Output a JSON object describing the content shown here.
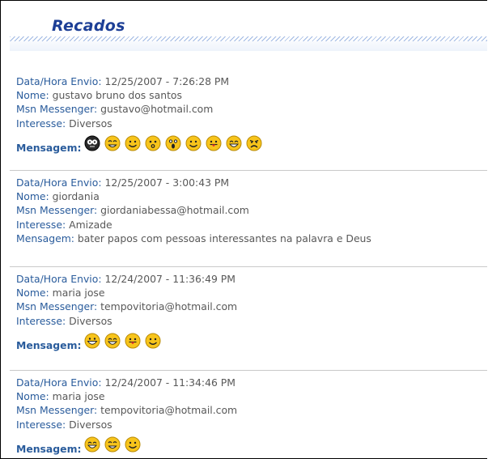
{
  "header": {
    "title": "Recados"
  },
  "posts": [
    {
      "date_label": "Data/Hora Envio:",
      "date": "12/25/2007 - 7:26:28 PM",
      "name_label": "Nome:",
      "name": "gustavo bruno dos santos",
      "msn_label": "Msn Messenger:",
      "msn": "gustavo@hotmail.com",
      "interest_label": "Interesse:",
      "interest": "Diversos",
      "message_label": "Mensagem:",
      "smileys": [
        "glasses-smiley-icon",
        "grin-smiley-icon",
        "smile-smiley-icon",
        "surprised-smiley-icon",
        "shocked-smiley-icon",
        "smile-smiley-icon",
        "tongue-smiley-icon",
        "laughing-smiley-icon",
        "angry-smiley-icon"
      ]
    },
    {
      "date_label": "Data/Hora Envio:",
      "date": "12/25/2007 - 3:00:43 PM",
      "name_label": "Nome:",
      "name": "giordania",
      "msn_label": "Msn Messenger:",
      "msn": "giordaniabessa@hotmail.com",
      "interest_label": "Interesse:",
      "interest": "Amizade",
      "message_label": "Mensagem:",
      "message": "bater papos com pessoas interessantes na palavra e Deus"
    },
    {
      "date_label": "Data/Hora Envio:",
      "date": "12/24/2007 - 11:36:49 PM",
      "name_label": "Nome:",
      "name": "maria jose",
      "msn_label": "Msn Messenger:",
      "msn": "tempovitoria@hotmail.com",
      "interest_label": "Interesse:",
      "interest": "Diversos",
      "message_label": "Mensagem:",
      "smileys": [
        "big-grin-smiley-icon",
        "laughing-smiley-icon",
        "tongue-smiley-icon",
        "smile-smiley-icon"
      ]
    },
    {
      "date_label": "Data/Hora Envio:",
      "date": "12/24/2007 - 11:34:46 PM",
      "name_label": "Nome:",
      "name": "maria jose",
      "msn_label": "Msn Messenger:",
      "msn": "tempovitoria@hotmail.com",
      "interest_label": "Interesse:",
      "interest": "Diversos",
      "message_label": "Mensagem:",
      "smileys": [
        "laughing-smiley-icon",
        "grin-smiley-icon",
        "smile-smiley-icon"
      ]
    }
  ],
  "colors": {
    "title": "#1d3f96",
    "label": "#2a5c9c",
    "text": "#585858",
    "smiley": "#f7c41b"
  }
}
